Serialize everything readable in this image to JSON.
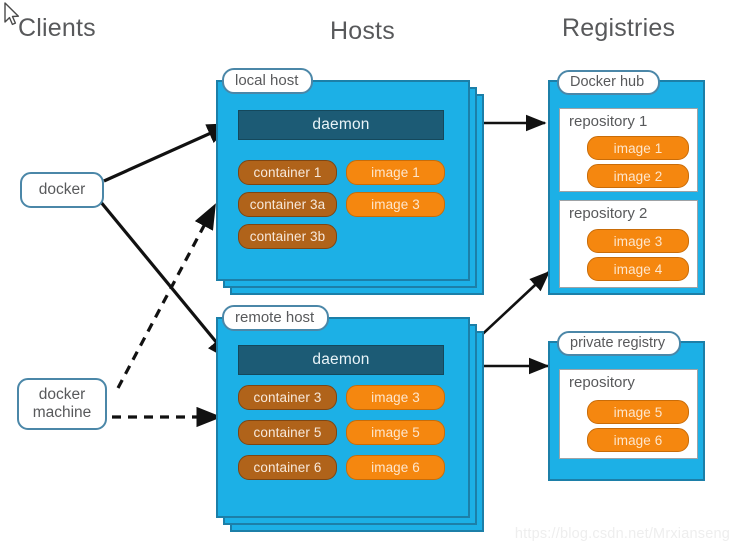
{
  "headings": {
    "clients": "Clients",
    "hosts": "Hosts",
    "registries": "Registries"
  },
  "clients": [
    {
      "id": "docker",
      "label": "docker"
    },
    {
      "id": "docker-machine",
      "line1": "docker",
      "line2": "machine"
    }
  ],
  "hosts": [
    {
      "id": "local-host",
      "label": "local host",
      "daemon": "daemon",
      "containers": [
        "container 1",
        "container 3a",
        "container 3b"
      ],
      "images": [
        "image 1",
        "image 3"
      ]
    },
    {
      "id": "remote-host",
      "label": "remote host",
      "daemon": "daemon",
      "containers": [
        "container 3",
        "container 5",
        "container 6"
      ],
      "images": [
        "image 3",
        "image 5",
        "image 6"
      ]
    }
  ],
  "registries": [
    {
      "id": "docker-hub",
      "label": "Docker hub",
      "repositories": [
        {
          "title": "repository 1",
          "images": [
            "image 1",
            "image 2"
          ]
        },
        {
          "title": "repository 2",
          "images": [
            "image 3",
            "image 4"
          ]
        }
      ]
    },
    {
      "id": "private-registry",
      "label": "private registry",
      "repositories": [
        {
          "title": "repository",
          "images": [
            "image 5",
            "image 6"
          ]
        }
      ]
    }
  ],
  "watermark": "https://blog.csdn.net/Mrxianseng",
  "colors": {
    "host_fill": "#1cb0e6",
    "host_border": "#1c7fa8",
    "daemon": "#1c5b75",
    "container": "#b0631a",
    "image": "#f5870f",
    "label_border": "#4b87a8",
    "text": "#58595b"
  }
}
